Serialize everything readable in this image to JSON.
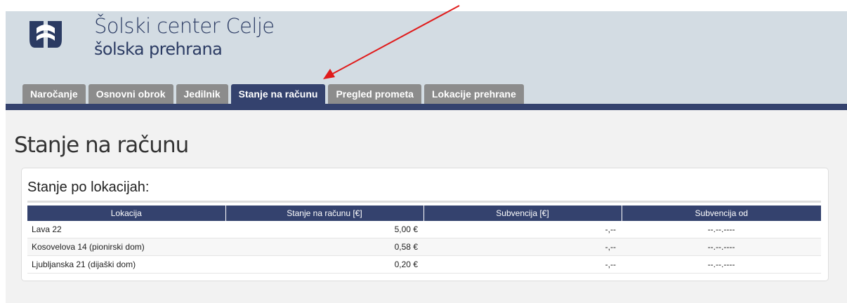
{
  "brand": {
    "title": "Šolski center Celje",
    "subtitle": "šolska prehrana"
  },
  "nav": {
    "tabs": [
      {
        "label": "Naročanje"
      },
      {
        "label": "Osnovni obrok"
      },
      {
        "label": "Jedilnik"
      },
      {
        "label": "Stanje na računu",
        "active": true
      },
      {
        "label": "Pregled prometa"
      },
      {
        "label": "Lokacije prehrane"
      }
    ]
  },
  "page": {
    "title": "Stanje na računu"
  },
  "panel": {
    "title": "Stanje po lokacijah:",
    "columns": [
      "Lokacija",
      "Stanje na računu [€]",
      "Subvencija [€]",
      "Subvencija od"
    ],
    "rows": [
      {
        "location": "Lava 22",
        "balance": "5,00 €",
        "subsidy": "-,--",
        "subsidy_from": "--.--.----"
      },
      {
        "location": "Kosovelova 14 (pionirski dom)",
        "balance": "0,58 €",
        "subsidy": "-,--",
        "subsidy_from": "--.--.----"
      },
      {
        "location": "Ljubljanska 21 (dijaški dom)",
        "balance": "0,20 €",
        "subsidy": "-,--",
        "subsidy_from": "--.--.----"
      }
    ]
  },
  "colors": {
    "navy": "#34426e",
    "header_bg": "#d3dce3",
    "tab_inactive": "#8c8c8c",
    "annotation_arrow": "#e01b1b"
  }
}
